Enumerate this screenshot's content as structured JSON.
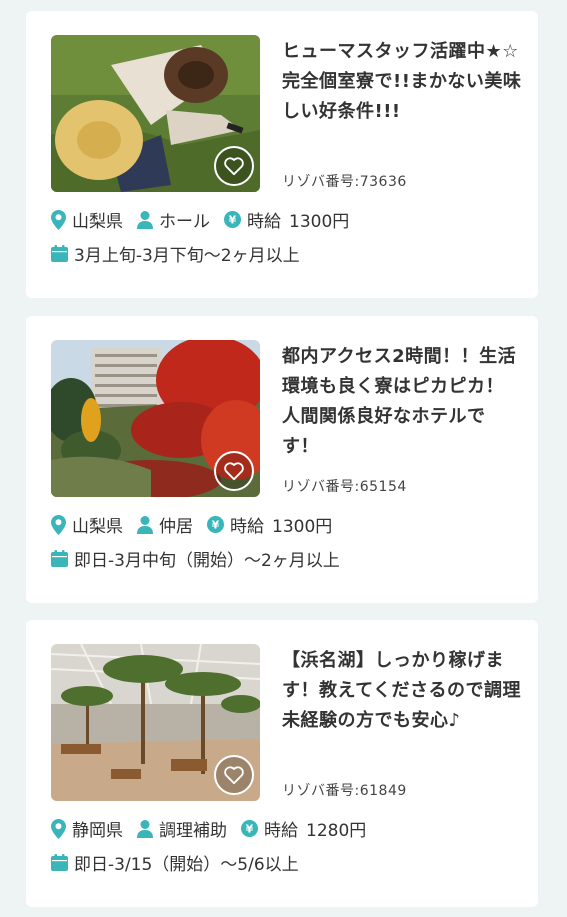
{
  "accent_color": "#3ab5b9",
  "icons": {
    "location": "map-pin-icon",
    "role": "person-icon",
    "wage": "yen-icon",
    "period": "calendar-icon",
    "favorite": "heart-icon"
  },
  "listings": [
    {
      "title": "ヒューマスタッフ活躍中★☆完全個室寮で!!まかない美味しい好条件!!!",
      "ref_number": "リゾバ番号:73636",
      "prefecture": "山梨県",
      "role": "ホール",
      "wage_type": "時給",
      "wage": "1300円",
      "period": "3月上旬-3月下旬〜2ヶ月以上"
    },
    {
      "title": "都内アクセス2時間！！生活環境も良く寮はピカピカ！人間関係良好なホテルです！",
      "ref_number": "リゾバ番号:65154",
      "prefecture": "山梨県",
      "role": "仲居",
      "wage_type": "時給",
      "wage": "1300円",
      "period": "即日-3月中旬（開始）〜2ヶ月以上"
    },
    {
      "title": "【浜名湖】しっかり稼げます！教えてくださるので調理未経験の方でも安心♪",
      "ref_number": "リゾバ番号:61849",
      "prefecture": "静岡県",
      "role": "調理補助",
      "wage_type": "時給",
      "wage": "1280円",
      "period": "即日-3/15（開始）〜5/6以上"
    }
  ]
}
